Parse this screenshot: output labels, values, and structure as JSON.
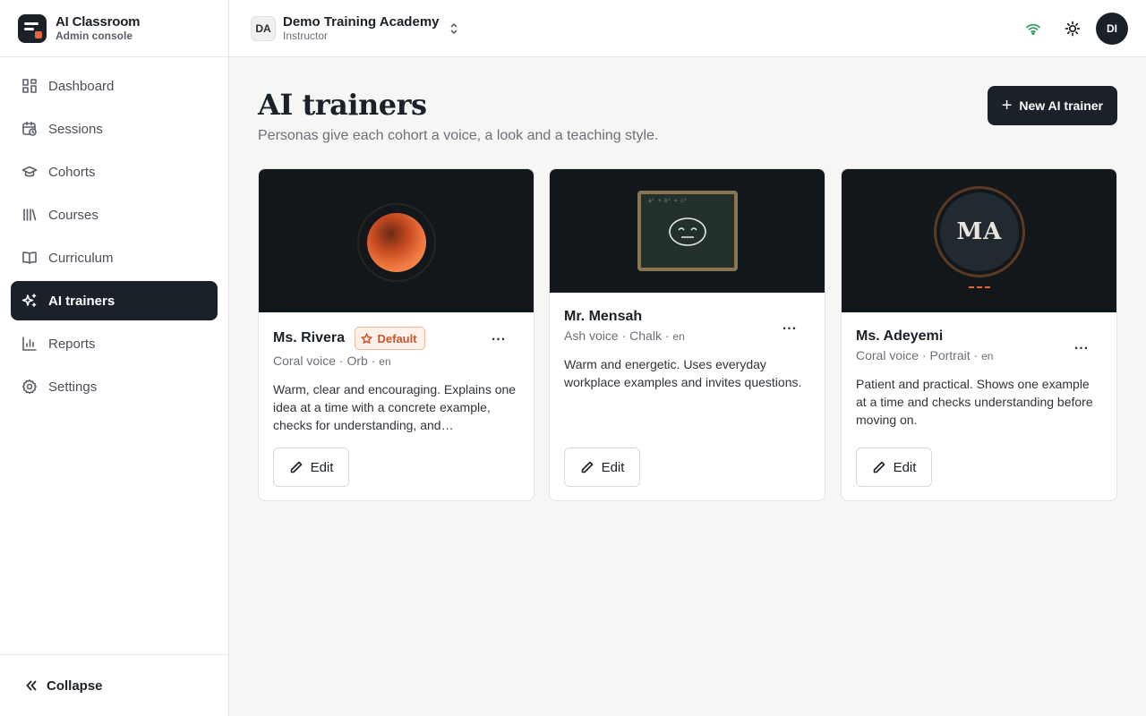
{
  "app": {
    "name": "AI Classroom",
    "subtitle": "Admin console"
  },
  "sidebar": {
    "items": [
      {
        "label": "Dashboard",
        "icon": "grid-icon",
        "active": false
      },
      {
        "label": "Sessions",
        "icon": "calendar-clock-icon",
        "active": false
      },
      {
        "label": "Cohorts",
        "icon": "graduation-cap-icon",
        "active": false
      },
      {
        "label": "Courses",
        "icon": "library-icon",
        "active": false
      },
      {
        "label": "Curriculum",
        "icon": "book-open-icon",
        "active": false
      },
      {
        "label": "AI trainers",
        "icon": "sparkles-icon",
        "active": true
      },
      {
        "label": "Reports",
        "icon": "bar-chart-icon",
        "active": false
      },
      {
        "label": "Settings",
        "icon": "gear-icon",
        "active": false
      }
    ],
    "collapse_label": "Collapse"
  },
  "topbar": {
    "org_initials": "DA",
    "org_name": "Demo Training Academy",
    "org_role": "Instructor",
    "user_initials": "DI",
    "icons": [
      "wifi-icon",
      "sun-icon"
    ]
  },
  "page": {
    "title": "AI trainers",
    "subtitle": "Personas give each cohort a voice, a look and a teaching style.",
    "new_button_label": "New AI trainer"
  },
  "trainers": [
    {
      "name": "Ms. Rivera",
      "badge": "Default",
      "voice": "Coral voice",
      "look": "Orb",
      "lang": "en",
      "description": "Warm, clear and encouraging. Explains one idea at a time with a concrete example, checks for understanding, and…",
      "edit_label": "Edit",
      "more_label": "..."
    },
    {
      "name": "Mr. Mensah",
      "badge": "",
      "voice": "Ash voice",
      "look": "Chalk",
      "lang": "en",
      "description": "Warm and energetic. Uses everyday workplace examples and invites questions.",
      "chalk_text": "a² + b² = c²",
      "edit_label": "Edit",
      "more_label": "..."
    },
    {
      "name": "Ms. Adeyemi",
      "badge": "",
      "voice": "Coral voice",
      "look": "Portrait",
      "lang": "en",
      "description": "Patient and practical. Shows one example at a time and checks understanding before moving on.",
      "portrait_initials": "MA",
      "edit_label": "Edit",
      "more_label": "..."
    }
  ],
  "colors": {
    "primary": "#1b2128",
    "accent": "#e8643c",
    "background": "#f6f6f5",
    "wifi": "#2e9e5b"
  }
}
